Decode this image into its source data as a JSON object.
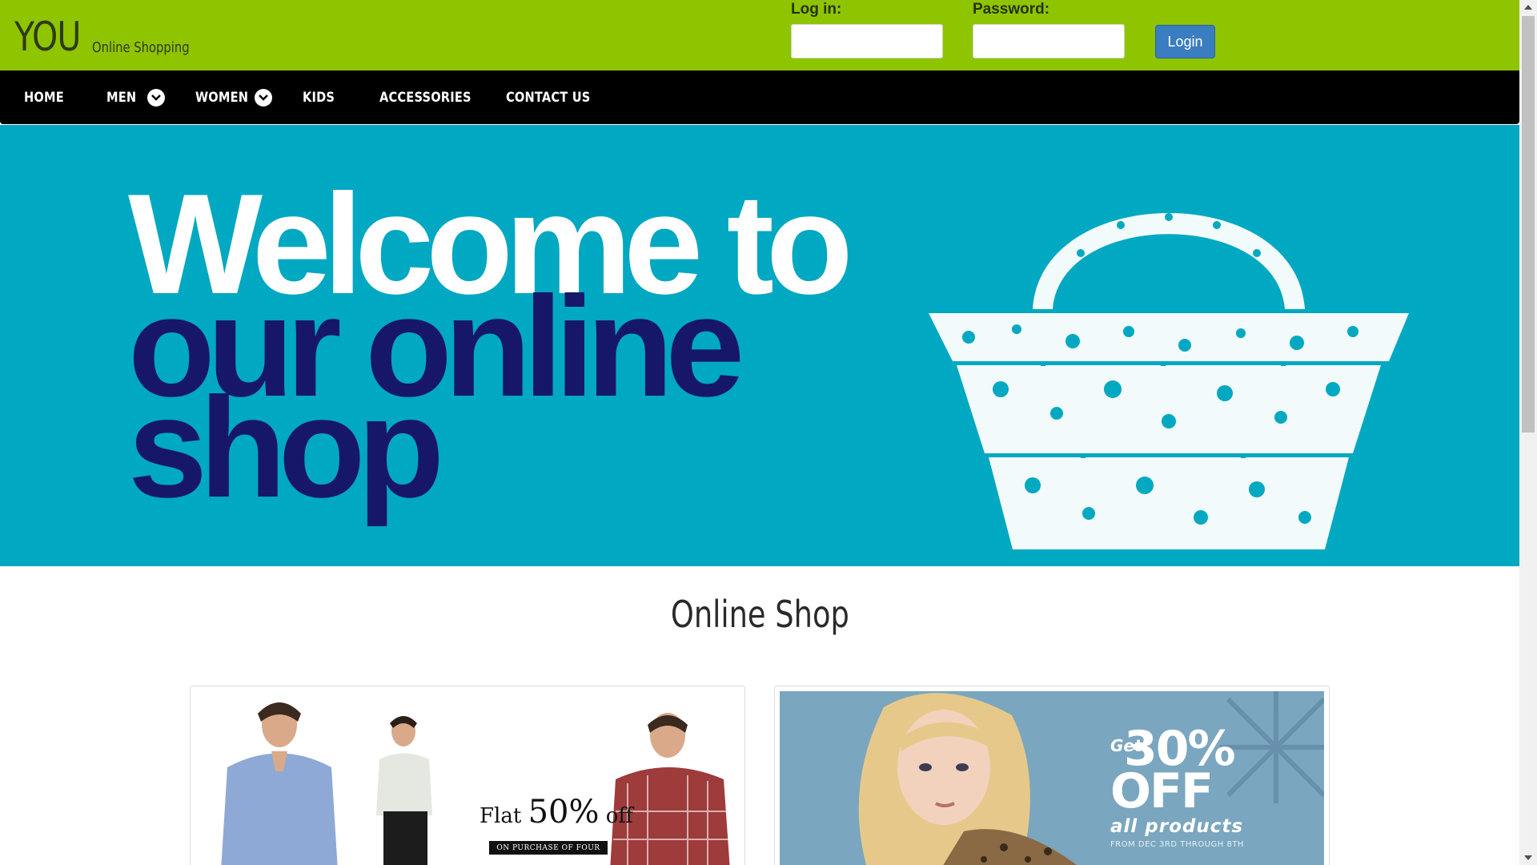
{
  "header": {
    "logo_main": "YOU",
    "logo_sub": "Online Shopping",
    "login_label": "Log in:",
    "login_value": "",
    "password_label": "Password:",
    "password_value": "",
    "login_button": "Login"
  },
  "nav": {
    "items": [
      {
        "label": "HOME"
      },
      {
        "label": "MEN",
        "dropdown": true
      },
      {
        "label": "WOMEN",
        "dropdown": true
      },
      {
        "label": "KIDS"
      },
      {
        "label": "ACCESSORIES"
      },
      {
        "label": "CONTACT US"
      }
    ]
  },
  "hero": {
    "line1": "Welcome to",
    "line2": "our online",
    "line3": "shop",
    "background_color": "#00a8c1",
    "accent_color": "#17176a",
    "basket_icon": "shopping-basket-icon"
  },
  "main": {
    "section_title": "Online Shop"
  },
  "promos": {
    "men": {
      "flat": "Flat ",
      "percent": "50%",
      "off": " off",
      "condition": "ON PURCHASE OF FOUR"
    },
    "women": {
      "get": "Get",
      "percent": "30%",
      "off": "OFF",
      "all_products": "all products",
      "dates": "FROM DEC 3RD THROUGH 8TH"
    }
  },
  "colors": {
    "topbar": "#8fc400",
    "navbar": "#000000",
    "login_button": "#3a7dc0"
  }
}
